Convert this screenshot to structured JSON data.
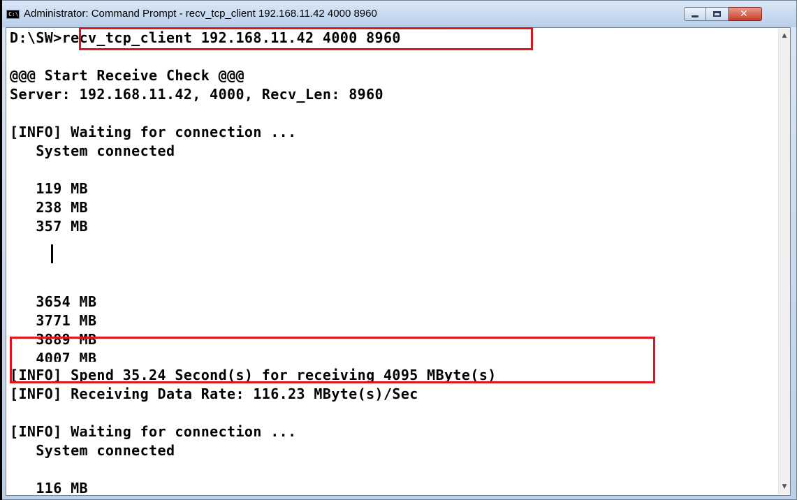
{
  "window": {
    "title": "Administrator: Command Prompt - recv_tcp_client  192.168.11.42 4000 8960",
    "icon": "cmd-icon",
    "icon_text": "C:\\",
    "buttons": {
      "minimize": "minimize-icon",
      "maximize": "maximize-icon",
      "close": "close-icon",
      "close_glyph": "✕"
    }
  },
  "console": {
    "prompt": "D:\\SW>",
    "command": "recv_tcp_client 192.168.11.42 4000 8960",
    "lines": {
      "start": "@@@ Start Receive Check @@@",
      "server": "Server: 192.168.11.42, 4000, Recv_Len: 8960",
      "wait1": "[INFO] Waiting for connection ...",
      "conn1": "   System connected",
      "mb1": "   119 MB",
      "mb2": "   238 MB",
      "mb3": "   357 MB",
      "mb4": "   3654 MB",
      "mb5": "   3771 MB",
      "mb6": "   3889 MB",
      "mb7": "   4007 MB",
      "spend": "[INFO] Spend 35.24 Second(s) for receiving 4095 MByte(s)",
      "rate": "[INFO] Receiving Data Rate: 116.23 MByte(s)/Sec",
      "wait2": "[INFO] Waiting for connection ...",
      "conn2": "   System connected",
      "mb8": "   116 MB"
    }
  },
  "scrollbar": {
    "up_glyph": "▲",
    "down_glyph": "▼"
  },
  "colors": {
    "highlight": "#e0141c",
    "console_bg": "#ffffff",
    "console_text": "#000000"
  }
}
